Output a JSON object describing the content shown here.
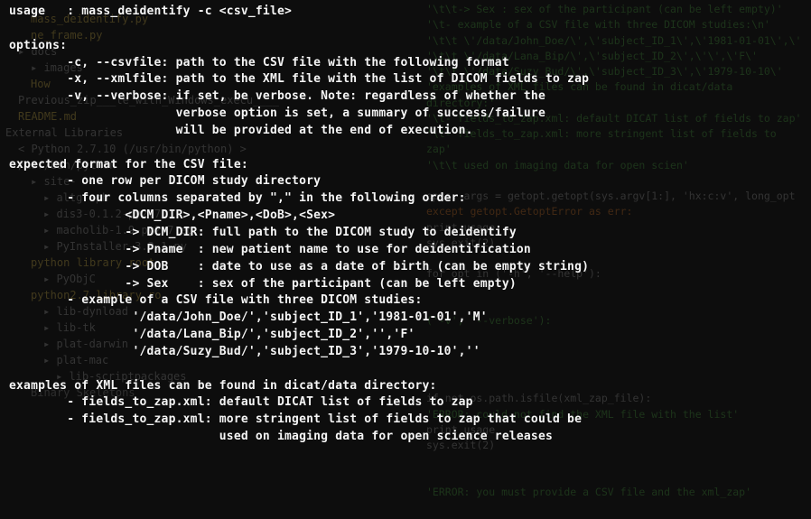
{
  "sidebar": {
    "items": [
      {
        "name": "mass_deidentify.py",
        "class": "file",
        "indent": 2
      },
      {
        "name": "ne_frame.py",
        "class": "file",
        "indent": 2
      },
      {
        "name": "docs",
        "class": "folder",
        "indent": 1
      },
      {
        "name": "images",
        "class": "folder",
        "indent": 2
      },
      {
        "name": "How",
        "class": "file",
        "indent": 2
      },
      {
        "name": "Previous_zip___le_with_Windows_execu____",
        "class": "info",
        "indent": 1
      },
      {
        "name": "README.md",
        "class": "readme",
        "indent": 1
      },
      {
        "name": "External Libraries",
        "class": "info",
        "indent": 0
      },
      {
        "name": "< Python 2.7.10 (/usr/bin/python) >  /usr/bin/python",
        "class": "info",
        "indent": 1
      },
      {
        "name": "site-",
        "class": "folder",
        "indent": 2
      },
      {
        "name": "altgraph",
        "class": "folder",
        "indent": 3
      },
      {
        "name": "dis3-0.1.2-py2.7",
        "class": "folder",
        "indent": 3
      },
      {
        "name": "macholib-1.9-py2.7.eg",
        "class": "folder",
        "indent": 3
      },
      {
        "name": "PyInstaller-3.3.1-py",
        "class": "folder",
        "indent": 3
      },
      {
        "name": "python  library root",
        "class": "file",
        "indent": 2
      },
      {
        "name": "PyObjC",
        "class": "folder",
        "indent": 3
      },
      {
        "name": "python2.7  library ro",
        "class": "file",
        "indent": 2
      },
      {
        "name": "lib-dynload",
        "class": "folder",
        "indent": 3
      },
      {
        "name": "lib-tk",
        "class": "folder",
        "indent": 3
      },
      {
        "name": "plat-darwin",
        "class": "folder",
        "indent": 3
      },
      {
        "name": "plat-mac",
        "class": "folder",
        "indent": 3
      },
      {
        "name": "lib-scriptpackages",
        "class": "folder",
        "indent": 4
      },
      {
        "name": "Binary Skeletons",
        "class": "bin",
        "indent": 2
      }
    ]
  },
  "bg_code": {
    "lines": [
      {
        "text": "'\\t\\t-> Sex     : sex of the participant (can be left empty)'",
        "class": "str"
      },
      {
        "text": "'\\t- example of a CSV file with three DICOM studies:\\n'",
        "class": "str"
      },
      {
        "text": "'\\t\\t \\'/data/John_Doe/\\',\\'subject_ID_1\\',\\'1981-01-01\\',\\'",
        "class": "str"
      },
      {
        "text": "'\\t\\t \\'/data/Lana_Bip/\\',\\'subject_ID_2\\',\\'\\',\\'F\\'",
        "class": "str"
      },
      {
        "text": "'\\t\\t \\'/data/Suzy_Bud/\\',\\'subject_ID_3\\',\\'1979-10-10\\'",
        "class": "str"
      },
      {
        "text": "'examples of XML files can be found in dicat/data directory:'",
        "class": "str"
      },
      {
        "text": "'\\t- fields_to_zap.xml: default DICAT list of fields to zap'",
        "class": "str"
      },
      {
        "text": "'\\t- fields_to_zap.xml: more stringent list of fields to zap'",
        "class": "str"
      },
      {
        "text": "'\\t\\t               used on imaging data for open scien'",
        "class": "str"
      },
      {
        "text": "",
        "class": "var"
      },
      {
        "text": "opts, args = getopt.getopt(sys.argv[1:], 'hx:c:v', long_opt",
        "class": "var"
      },
      {
        "text": "except getopt.GetoptError as err:",
        "class": "err"
      },
      {
        "text": "    print usage",
        "class": "call"
      },
      {
        "text": "    sys.exit(2)",
        "class": "call"
      },
      {
        "text": "",
        "class": "var"
      },
      {
        "text": "for opt in ('-h', '--help'):",
        "class": "var"
      },
      {
        "text": "",
        "class": "var"
      },
      {
        "text": "",
        "class": "var"
      },
      {
        "text": "('-v', '--verbose'):",
        "class": "str"
      },
      {
        "text": "",
        "class": "var"
      },
      {
        "text": "",
        "class": "var"
      },
      {
        "text": "",
        "class": "var"
      },
      {
        "text": "",
        "class": "var"
      },
      {
        "text": "if not os.path.isfile(xml_zap_file):",
        "class": "var"
      },
      {
        "text": "'ERROR: could not find the XML file with the list'",
        "class": "str"
      },
      {
        "text": "    print usage",
        "class": "call"
      },
      {
        "text": "    sys.exit(2)",
        "class": "call"
      },
      {
        "text": "",
        "class": "var"
      },
      {
        "text": "",
        "class": "var"
      },
      {
        "text": "'ERROR: you must provide a CSV file and the xml_zap'",
        "class": "str"
      }
    ]
  },
  "docstring": {
    "l01": "usage   : mass_deidentify -c <csv_file>",
    "l02": "",
    "l03": "options:",
    "l04": "        -c, --csvfile: path to the CSV file with the following format",
    "l05": "        -x, --xmlfile: path to the XML file with the list of DICOM fields to zap",
    "l06": "        -v, --verbose: if set, be verbose. Note: regardless of whether the",
    "l07": "                       verbose option is set, a summary of success/failure",
    "l08": "                       will be provided at the end of execution.",
    "l09": "",
    "l10": "expected format for the CSV file:",
    "l11": "        - one row per DICOM study directory",
    "l12": "        - four columns separated by \",\" in the following order:",
    "l13": "                <DCM_DIR>,<Pname>,<DoB>,<Sex>",
    "l14": "                -> DCM_DIR: full path to the DICOM study to deidentify",
    "l15": "                -> Pname  : new patient name to use for deidentification",
    "l16": "                -> DOB    : date to use as a date of birth (can be empty string)",
    "l17": "                -> Sex    : sex of the participant (can be left empty)",
    "l18": "        - example of a CSV file with three DICOM studies:",
    "l19": "                 '/data/John_Doe/','subject_ID_1','1981-01-01','M'",
    "l20": "                 '/data/Lana_Bip/','subject_ID_2','','F'",
    "l21": "                 '/data/Suzy_Bud/','subject_ID_3','1979-10-10',''",
    "l22": "",
    "l23": "examples of XML files can be found in dicat/data directory:",
    "l24": "        - fields_to_zap.xml: default DICAT list of fields to zap",
    "l25": "        - fields_to_zap.xml: more stringent list of fields to zap that could be",
    "l26": "                             used on imaging data for open science releases"
  }
}
